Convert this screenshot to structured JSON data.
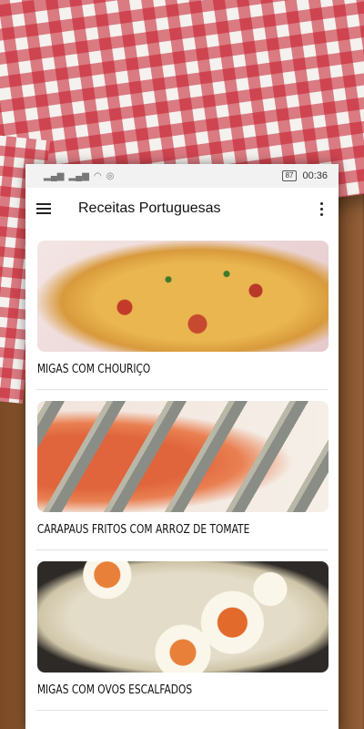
{
  "status_bar": {
    "time": "00:36",
    "battery": "87"
  },
  "app_bar": {
    "title": "Receitas Portuguesas"
  },
  "recipes": [
    {
      "title": "MIGAS COM CHOURIÇO",
      "image": "migas-com-chourico-photo"
    },
    {
      "title": "CARAPAUS FRITOS COM ARROZ DE TOMATE",
      "image": "carapaus-fritos-photo"
    },
    {
      "title": "MIGAS COM OVOS ESCALFADOS",
      "image": "migas-com-ovos-photo"
    }
  ],
  "colors": {
    "cloth_red": "#c41828",
    "wood": "#7a4a26",
    "app_bar_bg": "#ffffff",
    "status_bar_bg": "#f2f2f2"
  }
}
